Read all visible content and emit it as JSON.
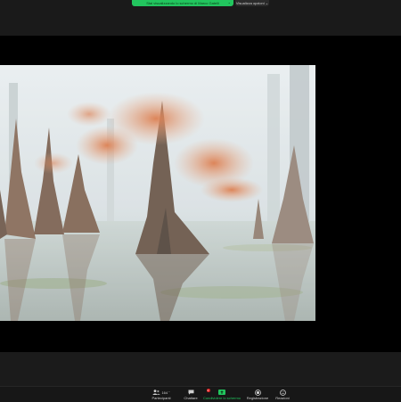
{
  "banner": {
    "share_text": "Stai visualizzando lo schermo di Marco Gatelli",
    "view_options_label": "Visualizza opzioni"
  },
  "toolbar": {
    "participants": {
      "label": "Partecipanti",
      "count": "164"
    },
    "chat": {
      "label": "Chattare",
      "badge_count": "2"
    },
    "share": {
      "label": "Condividere lo schermo"
    },
    "record": {
      "label": "Registrazione"
    },
    "reactions": {
      "label": "Reazioni"
    }
  },
  "colors": {
    "share_green": "#22c55e",
    "chat_badge": "#e02424",
    "stage_bg": "#000000",
    "toolbar_bg": "#171717"
  },
  "shared_content": {
    "icon": "photo-icon"
  }
}
